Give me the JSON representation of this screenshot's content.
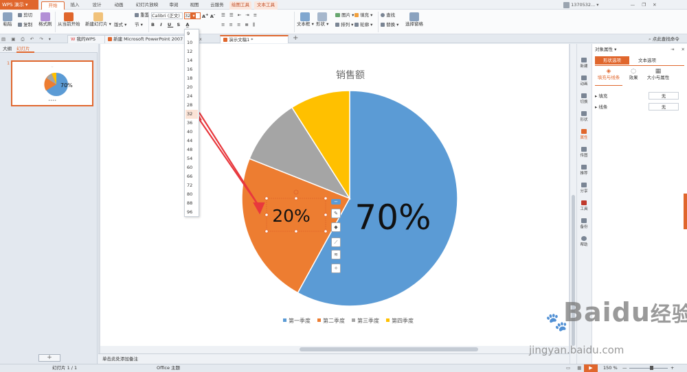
{
  "app": {
    "logo": "WPS 演示",
    "user": "1370532...",
    "window_buttons": [
      "—",
      "❐",
      "✕"
    ]
  },
  "menu_tabs": [
    "开始",
    "插入",
    "设计",
    "动画",
    "幻灯片放映",
    "审阅",
    "视图",
    "云服务",
    "绘图工具",
    "文本工具"
  ],
  "ribbon": {
    "paste": "粘贴",
    "cut": "剪切",
    "copy": "复制",
    "format_painter": "格式刷",
    "from_current": "从当前开始",
    "new_slide": "新建幻灯片",
    "layout": "版式",
    "section": "节",
    "reset": "重置",
    "font_name": "Calibri (正文)",
    "font_size": "32",
    "textbox": "文本框",
    "shape": "形状",
    "arrange": "排列",
    "outline": "轮廓",
    "picture": "图片",
    "fill": "填充",
    "find": "查找",
    "replace": "替换",
    "select_pane": "选择窗格"
  },
  "doc_tabs": [
    "我的WPS",
    "新建 Microsoft PowerPoint 2007 幻",
    "x",
    "演示文稿1 *"
  ],
  "search_label": "点此查找命令",
  "left_tabs": {
    "outline": "大纲",
    "slides": "幻灯片"
  },
  "slide_number": "1",
  "thumbnail_label": "70%",
  "font_size_options": [
    "9",
    "10",
    "12",
    "14",
    "16",
    "18",
    "20",
    "24",
    "28",
    "32",
    "36",
    "40",
    "44",
    "48",
    "54",
    "60",
    "66",
    "72",
    "80",
    "88",
    "96"
  ],
  "selected_size": "32",
  "chart_data": {
    "type": "pie",
    "title": "销售额",
    "categories": [
      "第一季度",
      "第二季度",
      "第三季度",
      "第四季度"
    ],
    "values": [
      58,
      23,
      10,
      9
    ],
    "colors": [
      "#5b9bd5",
      "#ed7d31",
      "#a5a5a5",
      "#ffc000"
    ],
    "data_labels": [
      "70%",
      "20%"
    ],
    "legend_position": "bottom"
  },
  "notes_placeholder": "单击此处添加备注",
  "side_icons": [
    "新建",
    "动画",
    "切换",
    "形状",
    "属性",
    "传图",
    "推荐",
    "分享",
    "工具",
    "备份",
    "帮助"
  ],
  "props": {
    "title": "对象属性",
    "tab_shape": "形状选项",
    "tab_text": "文本选项",
    "sub_fill_line": "填充与线条",
    "sub_effect": "效果",
    "sub_size": "大小与属性",
    "fill_label": "填充",
    "fill_value": "无",
    "line_label": "线条",
    "line_value": "无"
  },
  "status": {
    "slide_info": "幻灯片 1 / 1",
    "theme": "Office 主题",
    "zoom": "150 %"
  },
  "watermark": {
    "brand": "Baidu",
    "brand_cn": "经验",
    "url": "jingyan.baidu.com"
  }
}
